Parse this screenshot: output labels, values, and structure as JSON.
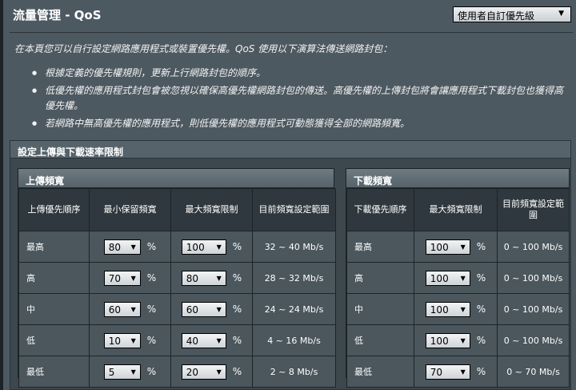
{
  "header": {
    "title": "流量管理 - QoS",
    "mode_select": "使用者自訂優先級"
  },
  "intro": "在本頁您可以自行設定網路應用程式或裝置優先權。QoS 使用以下演算法傳送網路封包：",
  "bullets": [
    "根據定義的優先權規則，更新上行網路封包的順序。",
    "低優先權的應用程式封包會被忽視以確保高優先權網路封包的傳送。高優先權的上傳封包將會讓應用程式下載封包也獲得高優先權。",
    "若網路中無高優先權的應用程式，則低優先權的應用程式可動態獲得全部的網路頻寬。"
  ],
  "panel": {
    "title": "設定上傳與下載速率限制"
  },
  "upload": {
    "title": "上傳頻寬",
    "headers": [
      "上傳優先順序",
      "最小保留頻寬",
      "最大頻寬限制",
      "目前頻寬設定範圍"
    ],
    "pct": "%",
    "rows": [
      {
        "priority": "最高",
        "min": "80",
        "max": "100",
        "range": "32 ~ 40 Mb/s"
      },
      {
        "priority": "高",
        "min": "70",
        "max": "80",
        "range": "28 ~ 32 Mb/s"
      },
      {
        "priority": "中",
        "min": "60",
        "max": "60",
        "range": "24 ~ 24 Mb/s"
      },
      {
        "priority": "低",
        "min": "10",
        "max": "40",
        "range": "4 ~ 16 Mb/s"
      },
      {
        "priority": "最低",
        "min": "5",
        "max": "20",
        "range": "2 ~ 8 Mb/s"
      }
    ]
  },
  "download": {
    "title": "下載頻寬",
    "headers": [
      "下載優先順序",
      "最大頻寬限制",
      "目前頻寬設定範圍"
    ],
    "pct": "%",
    "rows": [
      {
        "priority": "最高",
        "max": "100",
        "range": "0 ~ 100 Mb/s"
      },
      {
        "priority": "高",
        "max": "100",
        "range": "0 ~ 100 Mb/s"
      },
      {
        "priority": "中",
        "max": "100",
        "range": "0 ~ 100 Mb/s"
      },
      {
        "priority": "低",
        "max": "100",
        "range": "0 ~ 100 Mb/s"
      },
      {
        "priority": "最低",
        "max": "70",
        "range": "0 ~ 70 Mb/s"
      }
    ]
  }
}
